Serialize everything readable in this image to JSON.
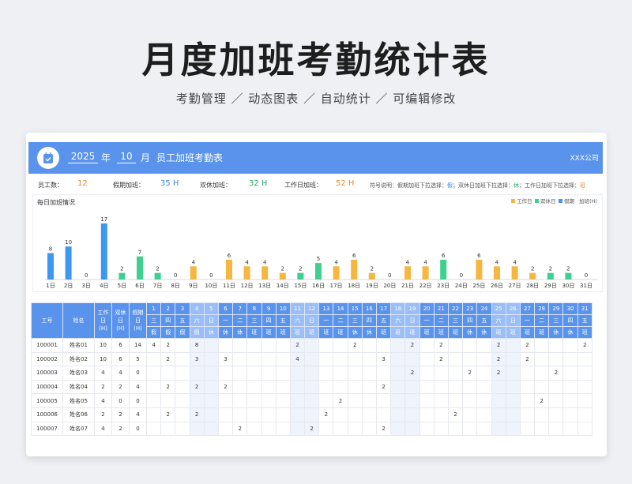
{
  "hero": {
    "title": "月度加班考勤统计表",
    "subtitle": "考勤管理  ／  动态图表  ／  自动统计 ／ 可编辑修改"
  },
  "topbar": {
    "year": "2025",
    "year_unit": "年",
    "month": "10",
    "month_unit": "月",
    "title": "员工加班考勤表",
    "company": "XXX公司",
    "icon": "calendar-check-icon"
  },
  "summary": {
    "staff_label": "员工数：",
    "staff_value": "12",
    "holiday_label": "假期加班：",
    "holiday_value": "35 H",
    "weekend_label": "双休加班：",
    "weekend_value": "32 H",
    "workday_label": "工作日加班：",
    "workday_value": "52 H",
    "symbol_note_parts": [
      "符号说明：假期加班下拉选择：",
      "假",
      "；双休日加班下拉选择：",
      "休",
      "；工作日加班下拉选择：",
      "班"
    ]
  },
  "colors": {
    "accent": "#5a93ec",
    "workday": "#f6b63f",
    "weekend": "#3fcf8e",
    "holiday": "#3c98f0",
    "staff": "#e08a2c",
    "holiday_value": "#3c86e0",
    "weekend_value": "#22a866",
    "workday_value": "#e08a2c"
  },
  "chart_data": {
    "type": "bar",
    "title": "每日加班情况",
    "legend": [
      "工作日",
      "双休日",
      "假期",
      "加班(H)"
    ],
    "legend_position": "top-right",
    "categories": [
      "1日",
      "2日",
      "3日",
      "4日",
      "5日",
      "6日",
      "7日",
      "8日",
      "9日",
      "10日",
      "11日",
      "12日",
      "13日",
      "14日",
      "15日",
      "16日",
      "17日",
      "18日",
      "19日",
      "20日",
      "21日",
      "22日",
      "23日",
      "24日",
      "25日",
      "26日",
      "27日",
      "28日",
      "29日",
      "30日",
      "31日"
    ],
    "values": [
      8,
      10,
      0,
      17,
      2,
      7,
      2,
      0,
      4,
      0,
      6,
      4,
      4,
      2,
      2,
      5,
      4,
      6,
      2,
      0,
      4,
      4,
      6,
      0,
      6,
      4,
      4,
      2,
      2,
      2,
      0
    ],
    "types": [
      "holiday",
      "holiday",
      "holiday",
      "holiday",
      "weekend",
      "weekend",
      "weekend",
      "holiday",
      "workday",
      "workday",
      "workday",
      "workday",
      "workday",
      "workday",
      "weekend",
      "weekend",
      "workday",
      "workday",
      "workday",
      "workday",
      "workday",
      "workday",
      "weekend",
      "weekend",
      "workday",
      "workday",
      "workday",
      "workday",
      "weekend",
      "weekend",
      "workday"
    ],
    "ylim": [
      0,
      17
    ]
  },
  "table": {
    "col_id": "工号",
    "col_name": "姓名",
    "col_workday": [
      "工作",
      "日",
      "(H)"
    ],
    "col_weekend": [
      "双休",
      "日",
      "(H)"
    ],
    "col_holiday": [
      "假期",
      "日",
      "(H)"
    ],
    "days": [
      "1",
      "2",
      "3",
      "4",
      "5",
      "6",
      "7",
      "8",
      "9",
      "10",
      "11",
      "12",
      "13",
      "14",
      "15",
      "16",
      "17",
      "18",
      "19",
      "20",
      "21",
      "22",
      "23",
      "24",
      "25",
      "26",
      "27",
      "28",
      "29",
      "30",
      "31"
    ],
    "weekdays": [
      "三",
      "四",
      "五",
      "六",
      "日",
      "一",
      "二",
      "三",
      "四",
      "五",
      "六",
      "日",
      "一",
      "二",
      "三",
      "四",
      "五",
      "六",
      "日",
      "一",
      "二",
      "三",
      "四",
      "五",
      "六",
      "日",
      "一",
      "二",
      "三",
      "四",
      "五"
    ],
    "daytypes": [
      "假",
      "假",
      "假",
      "假",
      "休",
      "休",
      "休",
      "班",
      "班",
      "班",
      "班",
      "班",
      "班",
      "班",
      "休",
      "休",
      "班",
      "班",
      "班",
      "班",
      "班",
      "班",
      "休",
      "休",
      "班",
      "班",
      "班",
      "班",
      "休",
      "休",
      "班"
    ],
    "weekend_cols": [
      3,
      4,
      10,
      11,
      17,
      18,
      24,
      25
    ],
    "rows": [
      {
        "id": "100001",
        "name": "姓名01",
        "w": "10",
        "s": "6",
        "h": "14",
        "d": {
          "0": "4",
          "1": "2",
          "3": "8",
          "10": "2",
          "14": "2",
          "18": "2",
          "20": "2",
          "24": "2",
          "26": "2",
          "30": "2"
        }
      },
      {
        "id": "100002",
        "name": "姓名02",
        "w": "10",
        "s": "6",
        "h": "5",
        "d": {
          "1": "2",
          "3": "3",
          "5": "3",
          "10": "4",
          "16": "3",
          "20": "2",
          "24": "2",
          "26": "2"
        }
      },
      {
        "id": "100003",
        "name": "姓名03",
        "w": "4",
        "s": "4",
        "h": "0",
        "d": {
          "18": "2",
          "22": "2",
          "24": "2",
          "28": "2"
        }
      },
      {
        "id": "100004",
        "name": "姓名04",
        "w": "2",
        "s": "2",
        "h": "4",
        "d": {
          "1": "2",
          "3": "2",
          "5": "2",
          "16": "2"
        }
      },
      {
        "id": "100005",
        "name": "姓名05",
        "w": "4",
        "s": "0",
        "h": "0",
        "d": {
          "13": "2",
          "27": "2"
        }
      },
      {
        "id": "100006",
        "name": "姓名06",
        "w": "2",
        "s": "2",
        "h": "4",
        "d": {
          "1": "2",
          "3": "2",
          "12": "2",
          "21": "2"
        }
      },
      {
        "id": "100007",
        "name": "姓名07",
        "w": "4",
        "s": "2",
        "h": "0",
        "d": {
          "6": "2",
          "11": "2",
          "16": "2"
        }
      }
    ]
  }
}
